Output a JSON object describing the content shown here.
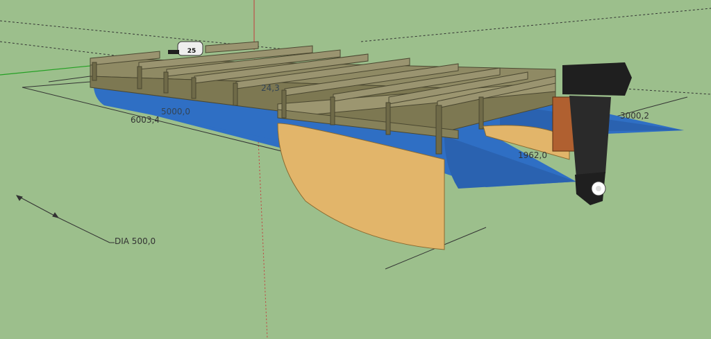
{
  "scene": {
    "background": "#9cbf8c",
    "float_color": "#2f6fc4",
    "plate_color": "#e2b56a",
    "wood_color": "#8f8a64",
    "motor_color": "#1f1f1f",
    "axis_red": "#c23b3b",
    "axis_green": "#22a022"
  },
  "dimensions": {
    "length": "6003,4",
    "width": "3000,2",
    "spacing": "1962,0",
    "inner_length": "5000,0",
    "height": "24,3",
    "diameter": "DIA 500,0"
  },
  "motor": {
    "icon": "outboard-motor-icon",
    "badge": "25"
  }
}
